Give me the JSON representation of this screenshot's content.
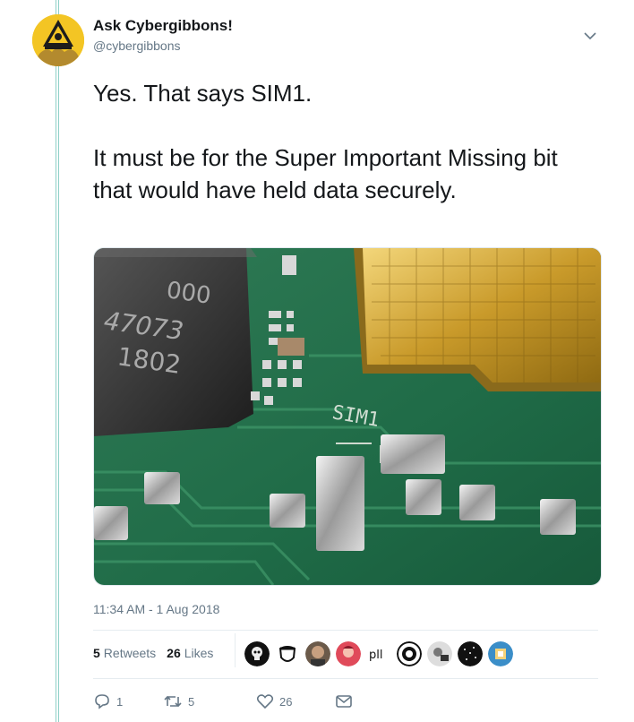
{
  "author": {
    "name": "Ask Cybergibbons!",
    "handle": "@cybergibbons",
    "avatar_icon": "gibbon-hazard-avatar"
  },
  "tweet": {
    "line1": "Yes. That says SIM1.",
    "line2": "It must be for the Super Important Missing bit that would have held data securely."
  },
  "photo": {
    "description_icon": "circuit-board-photo",
    "chip_text": [
      "000",
      "47073",
      "1802"
    ],
    "silkscreen": "SIM1"
  },
  "timestamp": "11:34 AM - 1 Aug 2018",
  "stats": {
    "retweets_count": "5",
    "retweets_label": "Retweets",
    "likes_count": "26",
    "likes_label": "Likes"
  },
  "actions": {
    "reply_count": "1",
    "retweet_count": "5",
    "like_count": "26"
  },
  "colors": {
    "thread_line": "#8fd0c7",
    "muted_text": "#657786",
    "body_text": "#14171a"
  }
}
